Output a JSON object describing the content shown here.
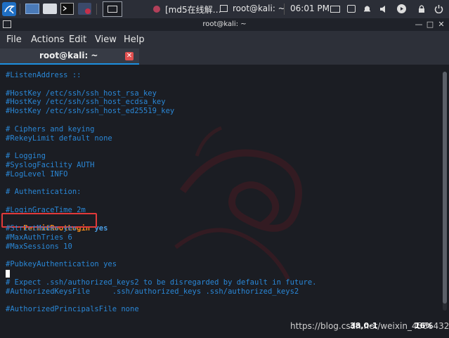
{
  "taskbar": {
    "window_tab_1": "[md5在线解…",
    "window_tab_2": "root@kali: ~",
    "clock": "06:01 PM"
  },
  "window": {
    "title": "root@kali: ~"
  },
  "menu": {
    "items": [
      "File",
      "Actions",
      "Edit",
      "View",
      "Help"
    ]
  },
  "tab": {
    "label": "root@kali: ~"
  },
  "terminal": {
    "lines": [
      "#ListenAddress ::",
      "",
      "#HostKey /etc/ssh/ssh_host_rsa_key",
      "#HostKey /etc/ssh/ssh_host_ecdsa_key",
      "#HostKey /etc/ssh/ssh_host_ed25519_key",
      "",
      "# Ciphers and keying",
      "#RekeyLimit default none",
      "",
      "# Logging",
      "#SyslogFacility AUTH",
      "#LogLevel INFO",
      "",
      "# Authentication:",
      "",
      "#LoginGraceTime 2m",
      "PermitRootLogin",
      "#StrictModes yes",
      "#MaxAuthTries 6",
      "#MaxSessions 10",
      "",
      "#PubkeyAuthentication yes",
      "",
      "# Expect .ssh/authorized_keys2 to be disregarded by default in future.",
      "#AuthorizedKeysFile     .ssh/authorized_keys .ssh/authorized_keys2",
      "",
      "#AuthorizedPrincipalsFile none"
    ],
    "permit_value": "yes",
    "status_position": "38,0-1",
    "status_percent": "16%",
    "watermark": "https://blog.csdn.net/weixin_45664323"
  },
  "colors": {
    "accent": "#1d8fe0",
    "comment": "#2a87d6",
    "highlight_box": "#e23a3a",
    "keyword_orange": "#f08a1b"
  }
}
